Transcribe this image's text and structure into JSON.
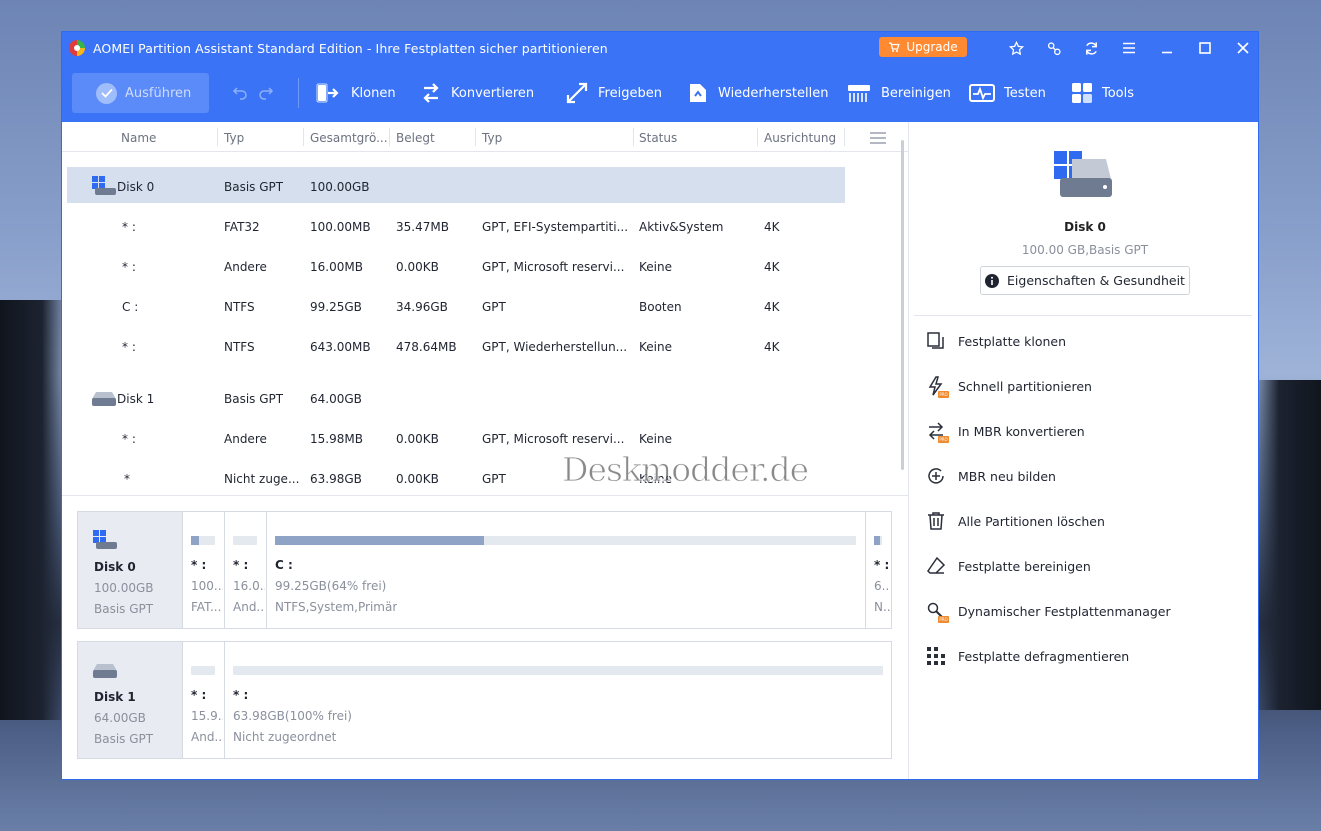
{
  "window": {
    "title": "AOMEI Partition Assistant Standard Edition - Ihre Festplatten sicher partitionieren",
    "upgrade_label": "Upgrade"
  },
  "toolbar": {
    "run_label": "Ausführen",
    "tools": [
      {
        "label": "Klonen",
        "icon": "clone-icon"
      },
      {
        "label": "Konvertieren",
        "icon": "convert-icon"
      },
      {
        "label": "Freigeben",
        "icon": "free-space-icon"
      },
      {
        "label": "Wiederherstellen",
        "icon": "restore-icon"
      },
      {
        "label": "Bereinigen",
        "icon": "wipe-icon"
      },
      {
        "label": "Testen",
        "icon": "test-icon"
      },
      {
        "label": "Tools",
        "icon": "tools-icon"
      }
    ]
  },
  "table": {
    "headers": [
      "Name",
      "Typ",
      "Gesamtgrö...",
      "Belegt",
      "Typ",
      "Status",
      "Ausrichtung"
    ],
    "rows": [
      {
        "name": "Disk 0",
        "typ": "Basis GPT",
        "size": "100.00GB",
        "used": "",
        "type": "",
        "status": "",
        "align": ""
      },
      {
        "name": "* :",
        "typ": "FAT32",
        "size": "100.00MB",
        "used": "35.47MB",
        "type": "GPT, EFI-Systempartiti...",
        "status": "Aktiv&System",
        "align": "4K"
      },
      {
        "name": "* :",
        "typ": "Andere",
        "size": "16.00MB",
        "used": "0.00KB",
        "type": "GPT, Microsoft reservi...",
        "status": "Keine",
        "align": "4K"
      },
      {
        "name": "C :",
        "typ": "NTFS",
        "size": "99.25GB",
        "used": "34.96GB",
        "type": "GPT",
        "status": "Booten",
        "align": "4K"
      },
      {
        "name": "* :",
        "typ": "NTFS",
        "size": "643.00MB",
        "used": "478.64MB",
        "type": "GPT, Wiederherstellun...",
        "status": "Keine",
        "align": "4K"
      },
      {
        "name": "Disk 1",
        "typ": "Basis GPT",
        "size": "64.00GB",
        "used": "",
        "type": "",
        "status": "",
        "align": ""
      },
      {
        "name": "* :",
        "typ": "Andere",
        "size": "15.98MB",
        "used": "0.00KB",
        "type": "GPT, Microsoft reservi...",
        "status": "Keine",
        "align": ""
      },
      {
        "name": "*",
        "typ": "Nicht zuge...",
        "size": "63.98GB",
        "used": "0.00KB",
        "type": "GPT",
        "status": "Keine",
        "align": ""
      }
    ]
  },
  "watermark": "Deskmodder.de",
  "diskmap": [
    {
      "name": "Disk 0",
      "size": "100.00GB",
      "style": "Basis GPT",
      "parts": [
        {
          "label": "* :",
          "l2": "100....",
          "l3": "FAT...",
          "fill": 0.35
        },
        {
          "label": "* :",
          "l2": "16.0...",
          "l3": "And...",
          "fill": 0
        },
        {
          "label": "C :",
          "l2": "99.25GB(64% frei)",
          "l3": "NTFS,System,Primär",
          "fill": 0.36
        },
        {
          "label": "* :",
          "l2": "6...",
          "l3": "N...",
          "fill": 0.75
        }
      ]
    },
    {
      "name": "Disk 1",
      "size": "64.00GB",
      "style": "Basis GPT",
      "parts": [
        {
          "label": "* :",
          "l2": "15.9...",
          "l3": "And...",
          "fill": 0
        },
        {
          "label": "* :",
          "l2": "63.98GB(100% frei)",
          "l3": "Nicht zugeordnet",
          "fill": 0
        }
      ]
    }
  ],
  "panel": {
    "disk_name": "Disk 0",
    "disk_sub": "100.00 GB,Basis GPT",
    "props_label": "Eigenschaften & Gesundheit",
    "ops": [
      {
        "label": "Festplatte klonen",
        "icon": "clone-disk-icon",
        "pro": false
      },
      {
        "label": "Schnell partitionieren",
        "icon": "quick-partition-icon",
        "pro": true
      },
      {
        "label": "In MBR konvertieren",
        "icon": "convert-mbr-icon",
        "pro": true
      },
      {
        "label": "MBR neu bilden",
        "icon": "rebuild-mbr-icon",
        "pro": false
      },
      {
        "label": "Alle Partitionen löschen",
        "icon": "trash-icon",
        "pro": false
      },
      {
        "label": "Festplatte bereinigen",
        "icon": "eraser-icon",
        "pro": false
      },
      {
        "label": "Dynamischer Festplattenmanager",
        "icon": "dynamic-disk-icon",
        "pro": true
      },
      {
        "label": "Festplatte defragmentieren",
        "icon": "defrag-icon",
        "pro": false
      }
    ]
  }
}
